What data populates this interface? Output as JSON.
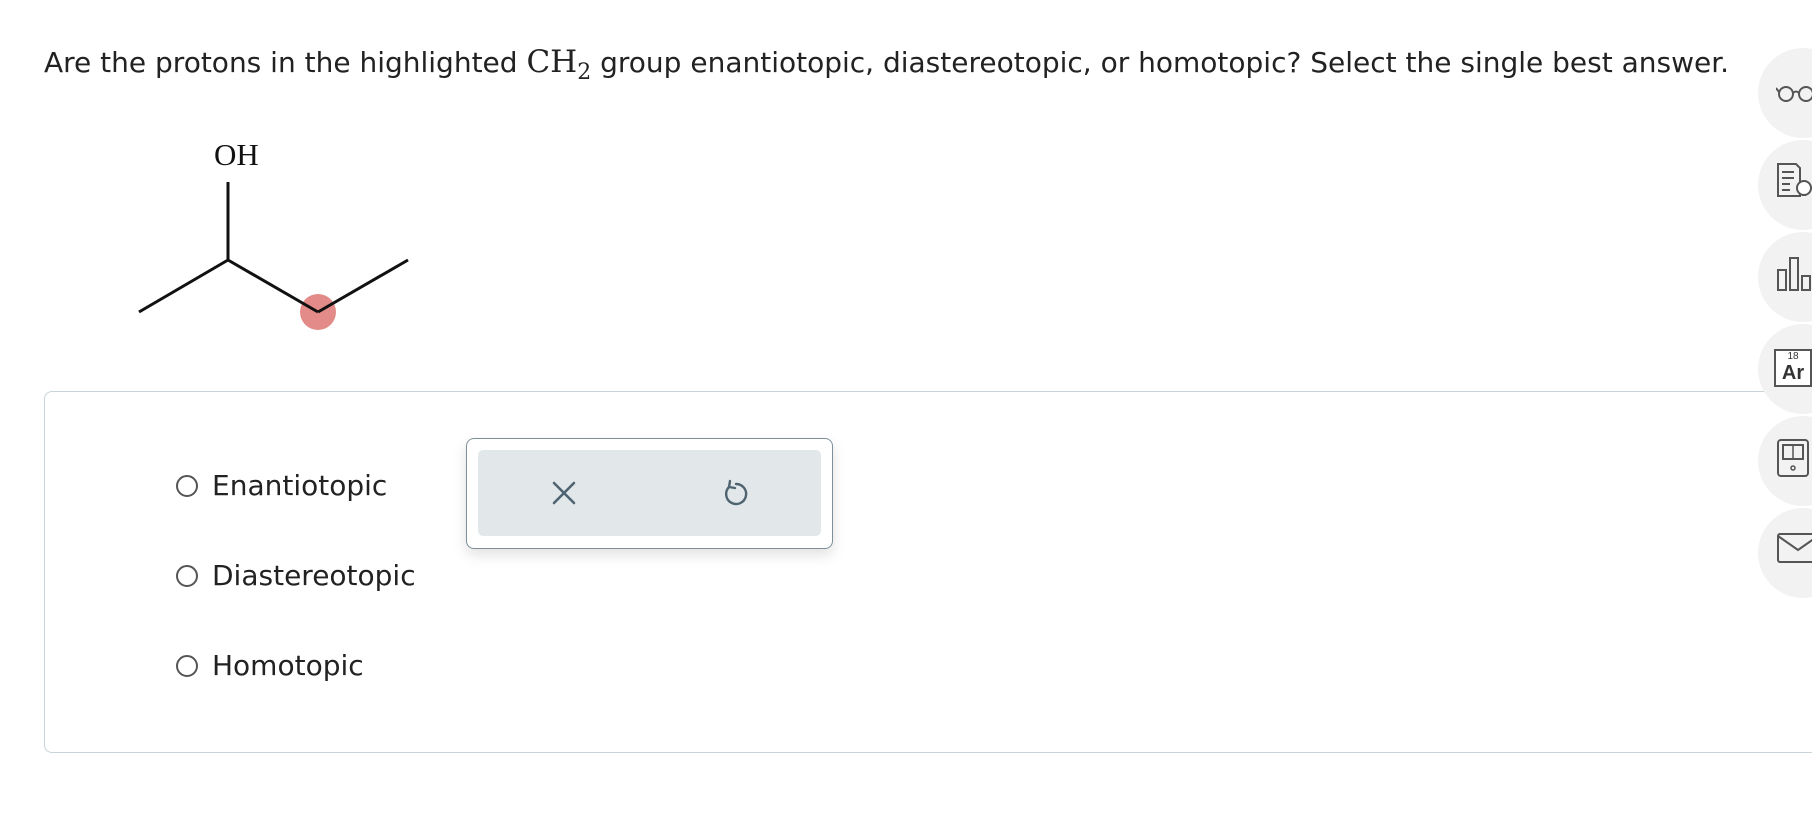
{
  "question": {
    "prefix": "Are the protons in the highlighted ",
    "group_main": "CH",
    "group_sub": "2",
    "suffix": " group enantiotopic, diastereotopic, or homotopic? Select the single best answer."
  },
  "molecule": {
    "label": "OH",
    "highlight_color": "#e28b88"
  },
  "options": [
    {
      "label": "Enantiotopic",
      "selected": false
    },
    {
      "label": "Diastereotopic",
      "selected": false
    },
    {
      "label": "Homotopic",
      "selected": false
    }
  ],
  "actions": {
    "clear_icon": "close-icon",
    "undo_icon": "undo-icon"
  },
  "side_tools": {
    "reader_icon": "glasses-icon",
    "hint_icon": "document-hint-icon",
    "stats_icon": "bar-chart-icon",
    "periodic_table": {
      "number": "18",
      "symbol": "Ar"
    },
    "calculator_icon": "calculator-icon",
    "mail_icon": "mail-icon"
  },
  "colors": {
    "accent_gray": "#7e8f99",
    "action_bg": "#e2e7ea",
    "panel_border": "#c9d3d8",
    "icon": "#4e6470"
  }
}
